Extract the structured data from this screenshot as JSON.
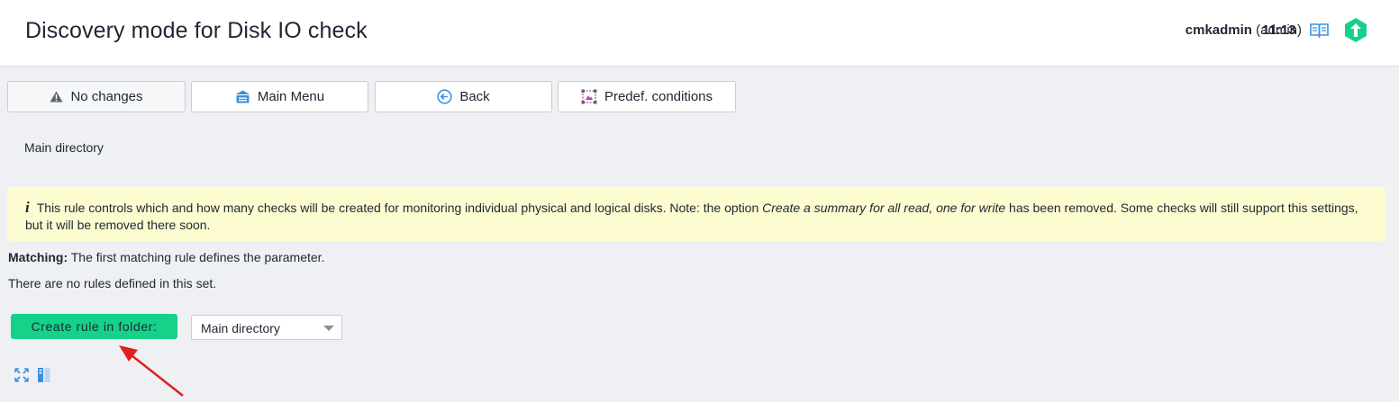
{
  "header": {
    "title": "Discovery mode for Disk IO check",
    "username": "cmkadmin",
    "role": "(admin)",
    "time": "11:13"
  },
  "toolbar": {
    "no_changes": "No changes",
    "main_menu": "Main Menu",
    "back": "Back",
    "predef_conditions": "Predef. conditions"
  },
  "breadcrumb": "Main directory",
  "info": {
    "icon_char": "i",
    "text_before": "This rule controls which and how many checks will be created for monitoring individual physical and logical disks. Note: the option ",
    "text_emphasis": "Create a summary for all read, one for write",
    "text_after": " has been removed. Some checks will still support this settings, but it will be removed there soon."
  },
  "matching": {
    "label": "Matching:",
    "text": " The first matching rule defines the parameter."
  },
  "no_rules": "There are no rules defined in this set.",
  "create_rule_button": "Create rule in folder:",
  "folder_select": {
    "value": "Main directory"
  },
  "colors": {
    "accent_green": "#15d18a",
    "info_bg": "#fdfbd0",
    "icon_blue": "#3c8fe6",
    "annotation_red": "#e0201c"
  },
  "icons": [
    "warning-icon",
    "main-menu-icon",
    "back-icon",
    "predef-conditions-icon",
    "manual-book-icon",
    "checkmk-logo-icon",
    "expand-icon",
    "columns-icon"
  ]
}
